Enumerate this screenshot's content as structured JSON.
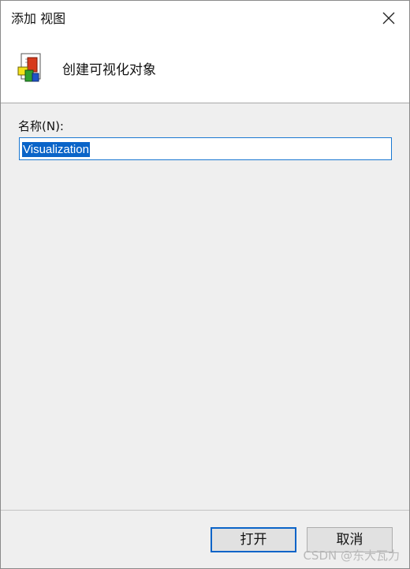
{
  "window": {
    "title": "添加 视图"
  },
  "header": {
    "icon": "visualization-object-icon",
    "text": "创建可视化对象"
  },
  "form": {
    "name_label": "名称(N):",
    "name_value": "Visualization"
  },
  "footer": {
    "open_label": "打开",
    "cancel_label": "取消"
  },
  "watermark": "CSDN @东大瓦力",
  "colors": {
    "accent": "#0a64c8",
    "panel": "#efefef"
  }
}
